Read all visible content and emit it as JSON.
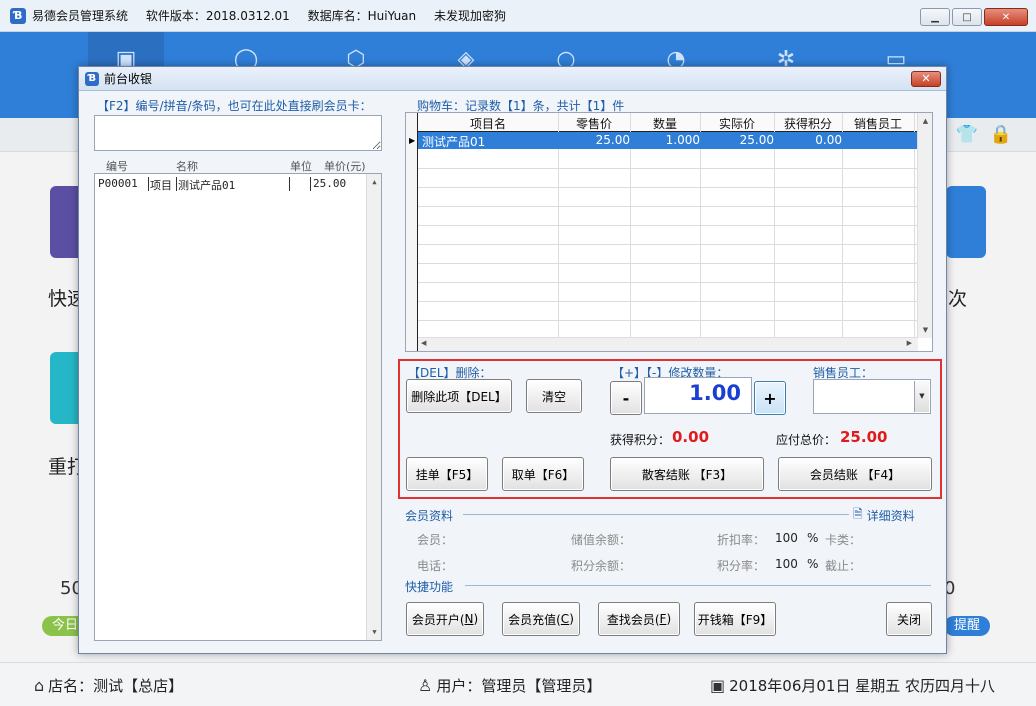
{
  "main": {
    "app_name": "易德会员管理系统",
    "version": "软件版本：2018.0312.01",
    "database": "数据库名：HuiYuan",
    "encryption": "未发现加密狗",
    "tiles": {
      "label_left_1": "快速",
      "label_left_2": "重打",
      "label_right_1": "次",
      "num_left": "50",
      "num_right": "0",
      "pill_left": "今日",
      "pill_right": "提醒"
    }
  },
  "status": {
    "store": "店名：测试【总店】",
    "user": "用户：管理员【管理员】",
    "date": "2018年06月01日 星期五 农历四月十八"
  },
  "dialog": {
    "title": "前台收银",
    "search": {
      "label": "【F2】编号/拼音/条码，也可在此处直接刷会员卡：",
      "value": ""
    },
    "product_list": {
      "headers": [
        "编号",
        "名称",
        "单位",
        "单价(元)"
      ],
      "rows": [
        {
          "code": "P00001",
          "type": "项目",
          "name": "测试产品01",
          "unit": "",
          "price": "25.00"
        }
      ]
    },
    "cart": {
      "summary": "购物车：记录数【1】条，共计【1】件",
      "headers": [
        "项目名",
        "零售价",
        "数量",
        "实际价",
        "获得积分",
        "销售员工"
      ],
      "rows": [
        {
          "name": "测试产品01",
          "retail": "25.00",
          "qty": "1.000",
          "actual": "25.00",
          "points": "0.00",
          "staff": ""
        }
      ]
    },
    "actions": {
      "delete_label": "【DEL】删除：",
      "qty_label": "【+】【-】修改数量：",
      "staff_label": "销售员工：",
      "delete_btn": "删除此项【DEL】",
      "clear_btn": "清空",
      "minus_btn": "-",
      "plus_btn": "+",
      "qty_value": "1.00",
      "staff_value": "",
      "points_label": "获得积分：",
      "points_value": "0.00",
      "total_label": "应付总价：",
      "total_value": "25.00",
      "hold_btn": "挂单【F5】",
      "retrieve_btn": "取单【F6】",
      "guest_checkout_btn": "散客结账 【F3】",
      "member_checkout_btn": "会员结账 【F4】"
    },
    "member_info": {
      "section_title": "会员资料",
      "detail_link": "详细资料",
      "member_label": "会员：",
      "stored_label": "储值余额：",
      "discount_label": "折扣率：",
      "discount_value": "100",
      "discount_unit": "%",
      "card_type_label": "卡类：",
      "phone_label": "电话：",
      "points_balance_label": "积分余额：",
      "points_rate_label": "积分率：",
      "points_rate_value": "100",
      "points_rate_unit": "%",
      "expiry_label": "截止："
    },
    "quick": {
      "section_title": "快捷功能",
      "open_member": {
        "pre": "会员开户(",
        "key": "N",
        "post": ")"
      },
      "recharge": {
        "pre": "会员充值(",
        "key": "C",
        "post": ")"
      },
      "find_member": {
        "pre": "查找会员(",
        "key": "F",
        "post": ")"
      },
      "open_drawer": "开钱箱【F9】",
      "close": "关闭"
    }
  },
  "colors": {
    "nav_blue": "#2f7fd8",
    "highlight_red": "#e03232",
    "qty_blue": "#1a3fd1",
    "value_red": "#e01b1b"
  }
}
